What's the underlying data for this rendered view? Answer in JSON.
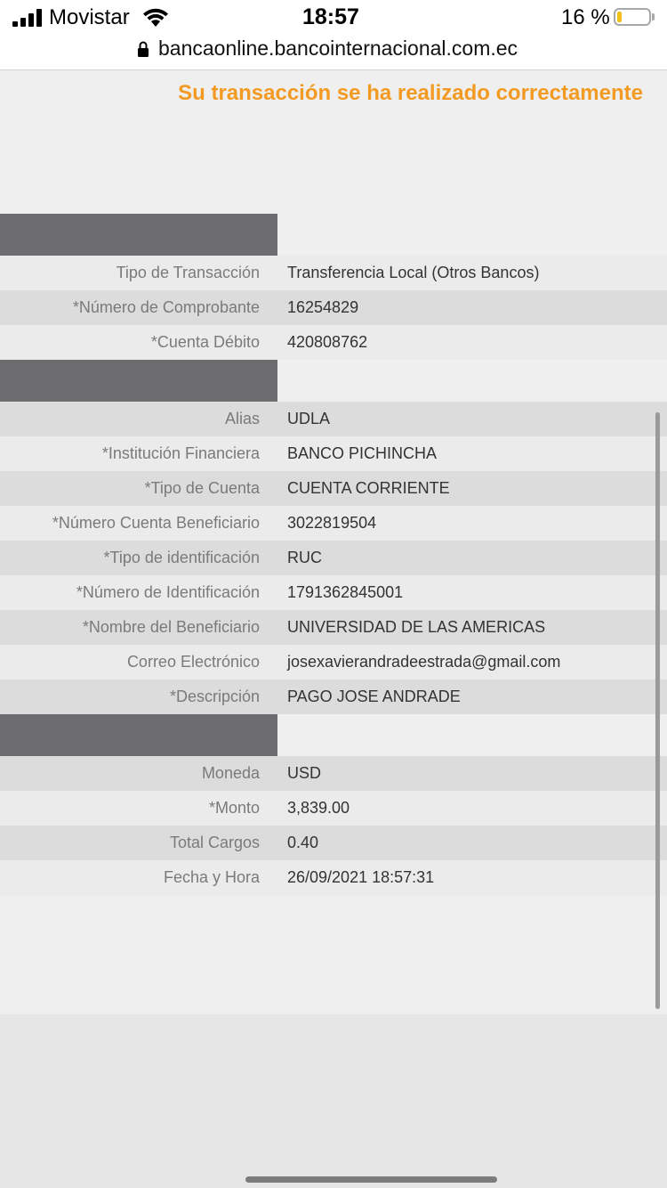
{
  "status_bar": {
    "carrier": "Movistar",
    "time": "18:57",
    "battery_percent": "16 %",
    "battery_level": 0.16,
    "battery_color": "#f2c014"
  },
  "browser": {
    "url": "bancaonline.bancointernacional.com.ec",
    "lock_icon": "lock-icon"
  },
  "page": {
    "success_message": "Su transacción se ha realizado correctamente",
    "accent_color": "#f39a23",
    "section_header_color": "#6d6d6f"
  },
  "sections": [
    {
      "rows": [
        {
          "label": "Tipo de Transacción",
          "value": "Transferencia Local (Otros Bancos)"
        },
        {
          "label": "*Número de Comprobante",
          "value": "16254829"
        },
        {
          "label": "*Cuenta Débito",
          "value": "420808762"
        }
      ]
    },
    {
      "rows": [
        {
          "label": "Alias",
          "value": "UDLA"
        },
        {
          "label": "*Institución Financiera",
          "value": "BANCO PICHINCHA"
        },
        {
          "label": "*Tipo de Cuenta",
          "value": "CUENTA CORRIENTE"
        },
        {
          "label": "*Número Cuenta Beneficiario",
          "value": "3022819504"
        },
        {
          "label": "*Tipo de identificación",
          "value": "RUC"
        },
        {
          "label": "*Número de Identificación",
          "value": "1791362845001"
        },
        {
          "label": "*Nombre del Beneficiario",
          "value": "UNIVERSIDAD DE LAS AMERICAS"
        },
        {
          "label": "Correo Electrónico",
          "value": "josexavierandradeestrada@gmail.com"
        },
        {
          "label": "*Descripción",
          "value": "PAGO JOSE ANDRADE"
        }
      ]
    },
    {
      "rows": [
        {
          "label": "Moneda",
          "value": "USD"
        },
        {
          "label": "*Monto",
          "value": "3,839.00"
        },
        {
          "label": "Total Cargos",
          "value": "0.40"
        },
        {
          "label": "Fecha y Hora",
          "value": "26/09/2021 18:57:31"
        }
      ]
    }
  ]
}
